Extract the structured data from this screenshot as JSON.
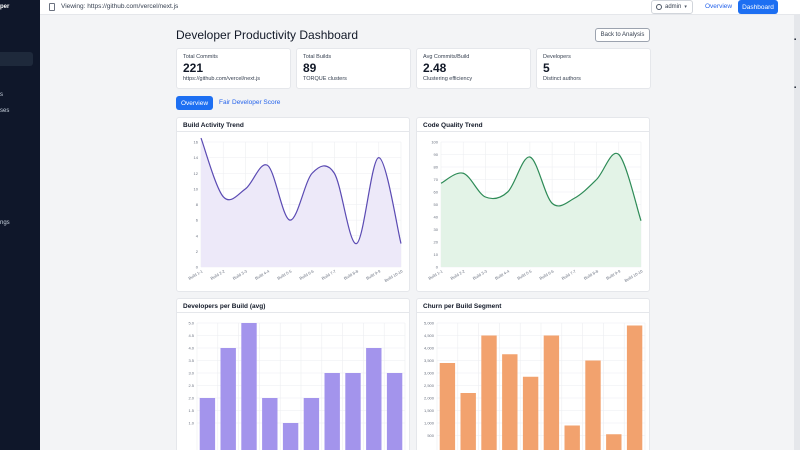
{
  "sidebar": {
    "brand": "per",
    "items": [
      {
        "label": "s"
      },
      {
        "label": "ses"
      },
      {
        "label": "ngs"
      }
    ]
  },
  "topbar": {
    "viewing": "Viewing: https://github.com/vercel/next.js",
    "user": "admin",
    "nav_overview": "Overview",
    "nav_dashboard": "Dashboard"
  },
  "page": {
    "title": "Developer Productivity Dashboard",
    "back_button": "Back to Analysis"
  },
  "stats": [
    {
      "label": "Total Commits",
      "value": "221",
      "sub": "https://github.com/vercel/next.js"
    },
    {
      "label": "Total Builds",
      "value": "89",
      "sub": "TORQUE clusters"
    },
    {
      "label": "Avg Commits/Build",
      "value": "2.48",
      "sub": "Clustering efficiency"
    },
    {
      "label": "Developers",
      "value": "5",
      "sub": "Distinct authors"
    }
  ],
  "tabs": {
    "overview": "Overview",
    "fair": "Fair Developer Score"
  },
  "panels": {
    "build_activity": "Build Activity Trend",
    "code_quality": "Code Quality Trend",
    "developers": "Developers per Build (avg)",
    "churn": "Churn per Build Segment"
  },
  "colors": {
    "primary": "#1d6ff2",
    "build_line": "#5b4bb3",
    "build_fill": "#ede9f9",
    "quality_line": "#2e8b57",
    "quality_fill": "#e3f3e7",
    "dev_bar": "#a394ec",
    "churn_bar": "#f2a26e"
  },
  "chart_data": [
    {
      "type": "area",
      "title": "Build Activity Trend",
      "categories": [
        "Build 1-1",
        "Build 2-2",
        "Build 3-3",
        "Build 4-4",
        "Build 5-5",
        "Build 6-6",
        "Build 7-7",
        "Build 8-8",
        "Build 9-9",
        "Build 10-10"
      ],
      "values": [
        16.5,
        9,
        10,
        13,
        6,
        12,
        12,
        3,
        14,
        3
      ],
      "ylim": [
        0,
        16
      ],
      "yticks": [
        0,
        2,
        4,
        6,
        8,
        10,
        12,
        14,
        16
      ],
      "grid": true
    },
    {
      "type": "area",
      "title": "Code Quality Trend",
      "categories": [
        "Build 1-1",
        "Build 2-2",
        "Build 3-3",
        "Build 4-4",
        "Build 5-5",
        "Build 6-6",
        "Build 7-7",
        "Build 8-8",
        "Build 9-9",
        "Build 10-10"
      ],
      "values": [
        67,
        75,
        56,
        60,
        88,
        51,
        55,
        70,
        90,
        37
      ],
      "ylim": [
        0,
        100
      ],
      "yticks": [
        0,
        10,
        20,
        30,
        40,
        50,
        60,
        70,
        80,
        90,
        100
      ],
      "grid": true
    },
    {
      "type": "bar",
      "title": "Developers per Build (avg)",
      "values": [
        2.0,
        4.0,
        5.0,
        2.0,
        1.0,
        2.0,
        3.0,
        3.0,
        4.0,
        3.0
      ],
      "ylim": [
        0,
        5
      ],
      "yticks": [
        "5.0",
        "4.5",
        "4.0",
        "3.5",
        "3.0",
        "2.5",
        "2.0",
        "1.5",
        "1.0"
      ],
      "grid": true
    },
    {
      "type": "bar",
      "title": "Churn per Build Segment",
      "values": [
        3400,
        2200,
        4500,
        3750,
        2850,
        4500,
        900,
        3500,
        550,
        4900
      ],
      "ylim": [
        0,
        5000
      ],
      "yticks": [
        "5,000",
        "4,500",
        "4,000",
        "3,500",
        "3,000",
        "2,500",
        "2,000",
        "1,500",
        "1,000",
        "500"
      ],
      "grid": true
    }
  ]
}
